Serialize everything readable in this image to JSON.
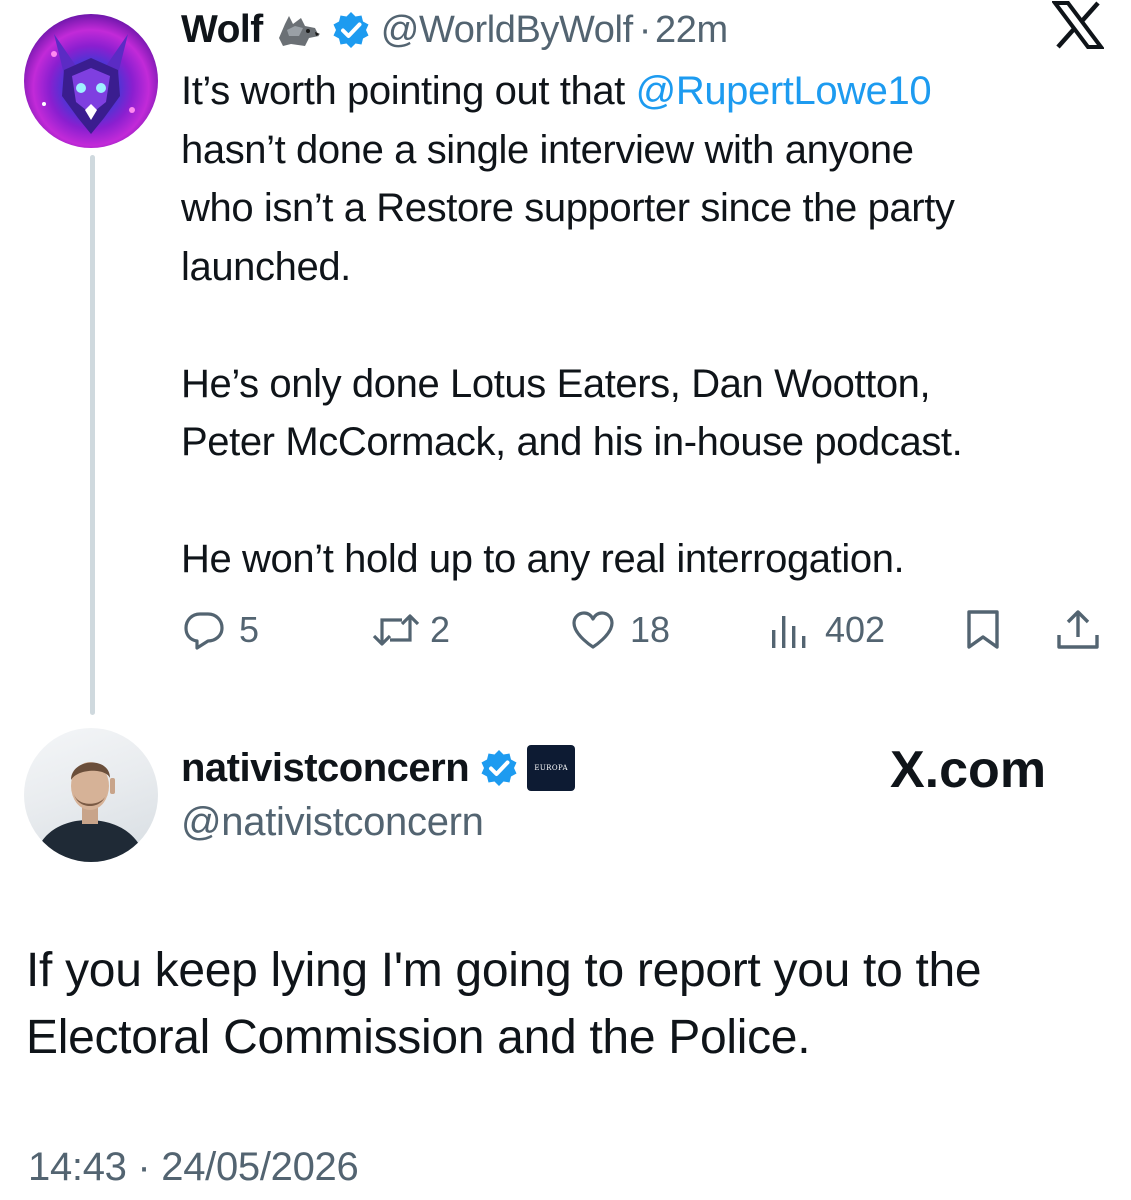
{
  "parent_tweet": {
    "display_name": "Wolf",
    "handle": "@WorldByWolf",
    "separator": "·",
    "time_ago": "22m",
    "text_line1_prefix": "It’s worth pointing out that ",
    "mention": "@RupertLowe10",
    "text_line2": "hasn’t done a single interview with anyone",
    "text_line3": "who isn’t a Restore supporter since the party",
    "text_line4": "launched.",
    "text_line6": "He’s only done Lotus Eaters, Dan Wootton,",
    "text_line7": "Peter McCormack, and his in-house podcast.",
    "text_line9": "He won’t hold up to any real interrogation.",
    "metrics": {
      "replies": "5",
      "reposts": "2",
      "likes": "18",
      "views": "402"
    },
    "icons": {
      "avatar": "wolf-avatar",
      "wolf_emoji": "wolf-icon",
      "verified": "verified-badge-icon",
      "x_logo": "x-logo-icon"
    }
  },
  "reply_tweet": {
    "display_name": "nativistconcern",
    "handle": "@nativistconcern",
    "affiliate_badge": "EUROPA",
    "watermark": "X.com",
    "text_line1": "If you keep lying I'm going to report you to the",
    "text_line2": "Electoral Commission and the Police.",
    "timestamp": "14:43 · 24/05/2026"
  },
  "colors": {
    "text_primary": "#0f1419",
    "text_secondary": "#536471",
    "link_blue": "#1d9bf0",
    "verified_blue": "#1d9bf0",
    "thread_line": "#cfd9de"
  }
}
